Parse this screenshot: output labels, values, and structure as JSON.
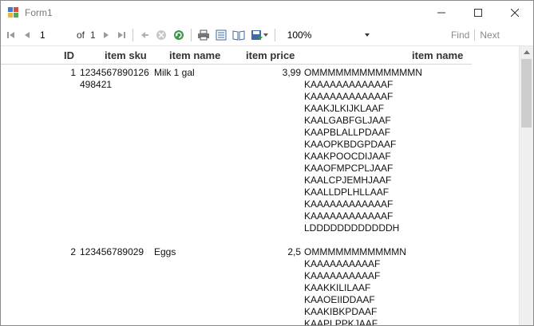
{
  "window": {
    "title": "Form1"
  },
  "toolbar": {
    "page_current": "1",
    "page_of_label": "of",
    "page_total": "1",
    "zoom": "100%",
    "find_label": "Find",
    "next_label": "Next"
  },
  "table": {
    "columns": [
      "ID",
      "item sku",
      "item name",
      "item price",
      "item name"
    ],
    "rows": [
      {
        "id": "1",
        "sku": "1234567890126\n498421",
        "name": "Milk 1 gal",
        "price": "3,99",
        "barcode": "OMMMMMMMMMMMMMN\nKAAAAAAAAAAAAF\nKAAAAAAAAAAAAF\nKAAKJLKIJKLAAF\nKAALGABFGLJAAF\nKAAPBLALLPDAAF\nKAAOPKBDGPDAAF\nKAAKPOOCDIJAAF\nKAAOFMPCPLJAAF\nKAALCPJEMHJAAF\nKAALLDPLHLLAAF\nKAAAAAAAAAAAAF\nKAAAAAAAAAAAAF\nLDDDDDDDDDDDDH"
      },
      {
        "id": "2",
        "sku": "123456789029",
        "name": "Eggs",
        "price": "2,5",
        "barcode": "OMMMMMMMMMMMN\nKAAAAAAAAAAF\nKAAAAAAAAAAF\nKAAKKILILAAF\nKAAOEIIDDAAF\nKAAKIBKPDAAF\nKAAPLPPKJAAF"
      }
    ]
  }
}
